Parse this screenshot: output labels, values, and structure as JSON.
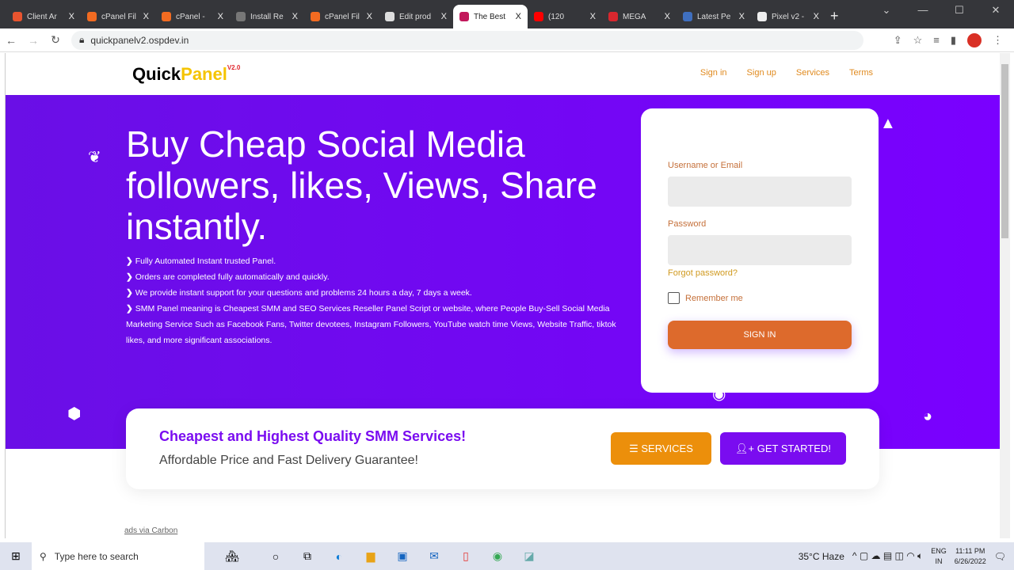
{
  "browser": {
    "tabs": [
      {
        "title": "Client Ar",
        "color": "#e8542f"
      },
      {
        "title": "cPanel Fil",
        "color": "#f26b21"
      },
      {
        "title": "cPanel -",
        "color": "#f26b21"
      },
      {
        "title": "Install Re",
        "color": "#777"
      },
      {
        "title": "cPanel Fil",
        "color": "#f26b21"
      },
      {
        "title": "Edit prod",
        "color": "#ddd"
      },
      {
        "title": "The Best",
        "color": "#c2185b",
        "active": true
      },
      {
        "title": "(120",
        "color": "#f00"
      },
      {
        "title": "MEGA",
        "color": "#d9272e"
      },
      {
        "title": "Latest Pe",
        "color": "#3f6fbf"
      },
      {
        "title": "Pixel v2 -",
        "color": "#eee"
      }
    ],
    "url": "quickpanelv2.ospdev.in",
    "close": "X",
    "new_tab": "+"
  },
  "site": {
    "logo_a": "Quick",
    "logo_b": "Panel",
    "logo_v": "V2.0",
    "nav": [
      "Sign in",
      "Sign up",
      "Services",
      "Terms"
    ],
    "hero_title": "Buy Cheap Social Media followers, likes, Views, Share instantly.",
    "bullets": [
      "Fully Automated Instant trusted Panel.",
      "Orders are completed fully automatically and quickly.",
      "We provide instant support for your questions and problems 24 hours a day, 7 days a week.",
      "SMM Panel meaning is Cheapest SMM and SEO Services Reseller Panel Script or website, where People Buy-Sell Social Media Marketing Service Such as Facebook Fans, Twitter devotees, Instagram Followers, YouTube watch time Views, Website Traffic, tiktok likes, and more significant associations."
    ],
    "login": {
      "username_label": "Username or Email",
      "password_label": "Password",
      "forgot": "Forgot password?",
      "remember": "Remember me",
      "submit": "SIGN IN"
    },
    "band": {
      "title": "Cheapest and Highest Quality SMM Services!",
      "subtitle": "Affordable Price and Fast Delivery Guarantee!",
      "services_btn": "SERVICES",
      "start_btn": "GET STARTED!"
    },
    "footer_tiny": "ads via Carbon"
  },
  "taskbar": {
    "search": "Type here to search",
    "weather": "35°C  Haze",
    "lang1": "ENG",
    "lang2": "IN",
    "time": "11:11 PM",
    "date": "6/26/2022"
  }
}
